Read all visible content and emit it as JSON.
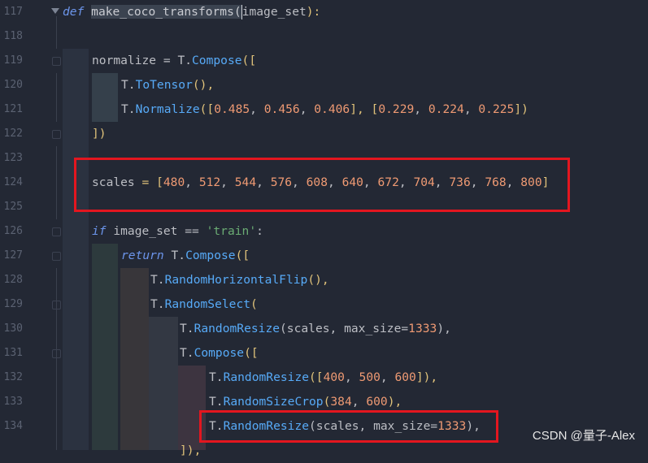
{
  "editor": {
    "line_numbers": [
      "117",
      "118",
      "119",
      "120",
      "121",
      "122",
      "123",
      "124",
      "125",
      "126",
      "127",
      "128",
      "129",
      "130",
      "131",
      "132",
      "133",
      "134"
    ],
    "code": {
      "l117": {
        "kw": "def",
        "name": "make_coco_transforms",
        "param": "image_set",
        "close": "):"
      },
      "l119": {
        "var": "normalize",
        "eq": " = ",
        "mod": "T.",
        "fn": "Compose",
        "open": "(["
      },
      "l120": {
        "mod": "T.",
        "fn": "ToTensor",
        "rest": "(),"
      },
      "l121": {
        "mod": "T.",
        "fn": "Normalize",
        "rest_a": "([",
        "n1": "0.485",
        "n2": "0.456",
        "n3": "0.406",
        "rest_b": "], [",
        "n4": "0.229",
        "n5": "0.224",
        "n6": "0.225",
        "rest_c": "])"
      },
      "l122": {
        "text": "])"
      },
      "l124": {
        "var": "scales",
        "eq": " = [",
        "values": [
          "480",
          "512",
          "544",
          "576",
          "608",
          "640",
          "672",
          "704",
          "736",
          "768",
          "800"
        ],
        "close": "]"
      },
      "l126": {
        "kw": "if",
        "var": " image_set ",
        "op": "==",
        "str": "'train'",
        "colon": ":"
      },
      "l127": {
        "kw": "return",
        "mod": " T.",
        "fn": "Compose",
        "open": "(["
      },
      "l128": {
        "mod": "T.",
        "fn": "RandomHorizontalFlip",
        "rest": "(),"
      },
      "l129": {
        "mod": "T.",
        "fn": "RandomSelect",
        "rest": "("
      },
      "l130": {
        "mod": "T.",
        "fn": "RandomResize",
        "args": "(scales, max_size=",
        "num": "1333",
        "rest": "),"
      },
      "l131": {
        "mod": "T.",
        "fn": "Compose",
        "open": "(["
      },
      "l132": {
        "mod": "T.",
        "fn": "RandomResize",
        "a": "([",
        "n1": "400",
        "n2": "500",
        "n3": "600",
        "b": "]),"
      },
      "l133": {
        "mod": "T.",
        "fn": "RandomSizeCrop",
        "a": "(",
        "n1": "384",
        "n2": "600",
        "b": "),"
      },
      "l134": {
        "mod": "T.",
        "fn": "RandomResize",
        "args": "(scales, max_size=",
        "num": "1333",
        "rest": "),"
      },
      "l135": {
        "text": "]),"
      }
    }
  },
  "watermark": "CSDN @量子-Alex",
  "colors": {
    "highlight_box": "#e3161f",
    "keyword": "#6c95eb",
    "function": "#57aaf7",
    "number": "#ef9a73",
    "string": "#6aab73"
  }
}
